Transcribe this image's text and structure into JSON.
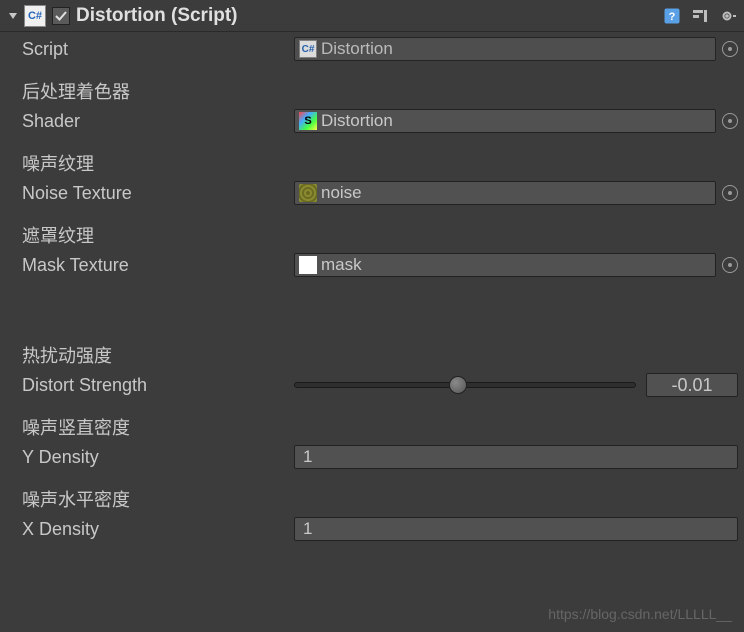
{
  "header": {
    "title": "Distortion (Script)",
    "enabled": true,
    "cs_label": "C#"
  },
  "fields": {
    "script": {
      "label": "Script",
      "value": "Distortion",
      "icon_label": "C#"
    },
    "shader_section": "后处理着色器",
    "shader": {
      "label": "Shader",
      "value": "Distortion",
      "icon_label": "S"
    },
    "noise_section": "噪声纹理",
    "noise": {
      "label": "Noise Texture",
      "value": "noise"
    },
    "mask_section": "遮罩纹理",
    "mask": {
      "label": "Mask Texture",
      "value": "mask"
    },
    "distort_section": "热扰动强度",
    "distort": {
      "label": "Distort Strength",
      "value": "-0.01",
      "slider_pos_pct": 48
    },
    "ydensity_section": "噪声竖直密度",
    "ydensity": {
      "label": "Y Density",
      "value": "1"
    },
    "xdensity_section": "噪声水平密度",
    "xdensity": {
      "label": "X Density",
      "value": "1"
    }
  },
  "watermark": "https://blog.csdn.net/LLLLL__"
}
